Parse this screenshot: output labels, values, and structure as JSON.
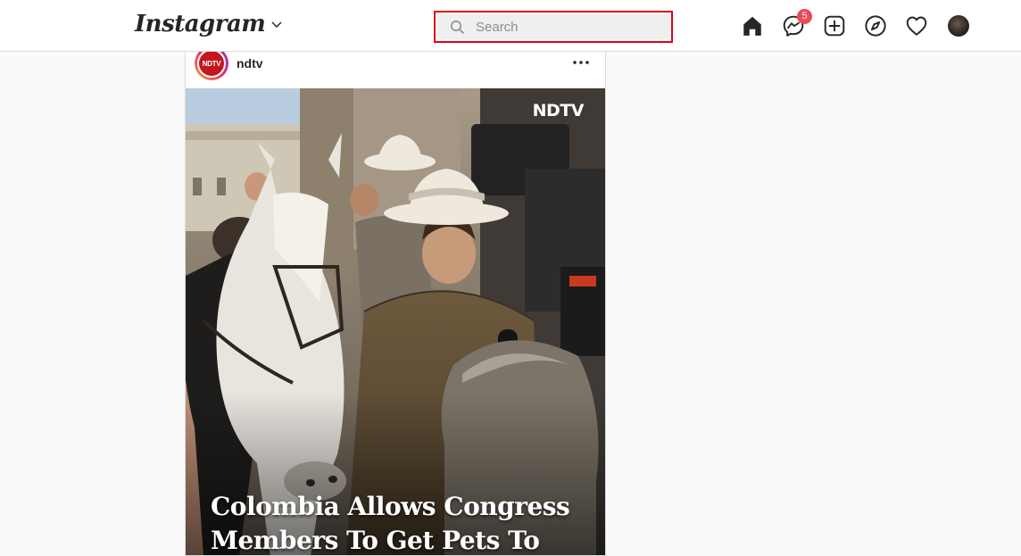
{
  "header": {
    "logo_text": "Instagram",
    "search_placeholder": "Search",
    "messenger_badge": "5"
  },
  "nav": {
    "icons": [
      "home-icon",
      "messenger-icon",
      "new-post-icon",
      "explore-icon",
      "activity-heart-icon",
      "profile-avatar"
    ]
  },
  "post": {
    "username": "ndtv",
    "avatar_text": "NDTV",
    "image_logo": "NDTV",
    "headline": "Colombia Allows Congress Members To Get Pets To"
  },
  "colors": {
    "highlight_border": "#e0001b",
    "badge": "#ed4956",
    "ndtv_red": "#c4161c"
  }
}
